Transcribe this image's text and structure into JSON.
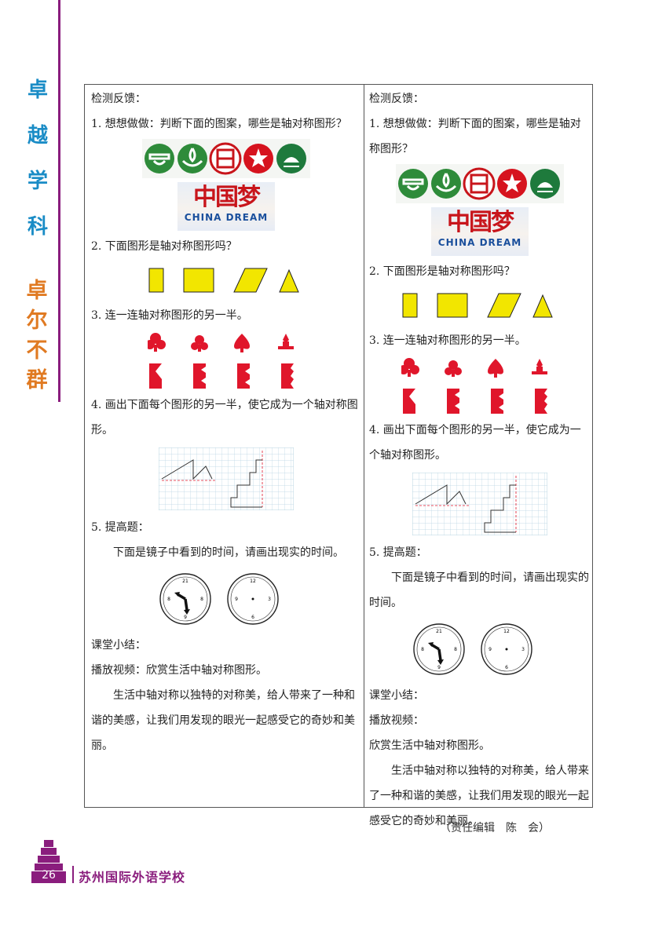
{
  "side": {
    "title_chars": [
      "卓",
      "越",
      "学",
      "科"
    ],
    "motto_chars": [
      "卓",
      "尔",
      "不",
      "群"
    ]
  },
  "left": {
    "heading": "检测反馈：",
    "q1": "1. 想想做做：判断下面的图案，哪些是轴对称图形？",
    "china_dream_cn": "中国梦",
    "china_dream_en": "CHINA DREAM",
    "q2": "2. 下面图形是轴对称图形吗？",
    "q3": "3. 连一连轴对称图形的另一半。",
    "q4": "4.  画出下面每个图形的另一半，使它成为一个轴对称图形。",
    "q5": "5. 提高题：",
    "q5_text": "下面是镜子中看到的时间，请画出现实的时间。",
    "summary": "课堂小结：",
    "video": "播放视频：欣赏生活中轴对称图形。",
    "closing": "生活中轴对称以独特的对称美，给人带来了一种和谐的美感，让我们用发现的眼光一起感受它的奇妙和美丽。"
  },
  "right": {
    "heading": "检测反馈：",
    "q1": "1. 想想做做：判断下面的图案，哪些是轴对称图形？",
    "china_dream_cn": "中国梦",
    "china_dream_en": "CHINA DREAM",
    "q2": "2. 下面图形是轴对称图形吗？",
    "q3": "3. 连一连轴对称图形的另一半。",
    "q4": "4. 画出下面每个图形的另一半，使它成为一个轴对称图形。",
    "q5": "5. 提高题：",
    "q5_text": "下面是镜子中看到的时间，请画出现实的时间。",
    "summary": "课堂小结：",
    "video": "播放视频：",
    "video2": "欣赏生活中轴对称图形。",
    "closing": "生活中轴对称以独特的对称美，给人带来了一种和谐的美感，让我们用发现的眼光一起感受它的奇妙和美丽。"
  },
  "clock_numbers": {
    "top": "12",
    "right": "3",
    "bottom": "6",
    "left": "9",
    "mirror_top": "21",
    "mirror_right": "8",
    "mirror_bottom": "9",
    "mirror_left": "8"
  },
  "footer": {
    "editor": "（责任编辑　陈　会）",
    "page_number": "26",
    "school": "苏州国际外语学校"
  },
  "colors": {
    "accent_purple": "#8a1d7d",
    "title_blue": "#1a8cc6",
    "motto_orange": "#e07a22",
    "shape_yellow": "#f2e600",
    "suit_red": "#e0162b",
    "logo_green": "#2e8b3a"
  }
}
